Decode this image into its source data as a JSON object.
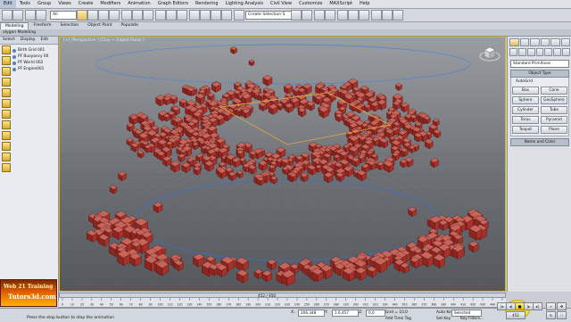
{
  "menu": [
    "Edit",
    "Tools",
    "Group",
    "Views",
    "Create",
    "Modifiers",
    "Animation",
    "Graph Editors",
    "Rendering",
    "Lighting Analysis",
    "Civil View",
    "Customize",
    "MAXScript",
    "Help"
  ],
  "toolbar": {
    "filter_value": "All",
    "selection_set_placeholder": "Create Selection S"
  },
  "ribbon": {
    "tabs": [
      "Modeling",
      "Freeform",
      "Selection",
      "Object Paint",
      "Populate"
    ],
    "active_tab": "Modeling",
    "sub_label": "olygon Modeling"
  },
  "scene_explorer": {
    "tabs": [
      "Select",
      "Display",
      "Edit"
    ],
    "items": [
      "Birth Grid 001",
      "PF Buoyancy 00",
      "PF World 002",
      "PF Engine001"
    ]
  },
  "viewport": {
    "label": "[+] [Perspective ] [Clay + Edged Faces ]"
  },
  "command_panel": {
    "category_dropdown": "Standard Primitives",
    "object_type_title": "Object Type",
    "autogrid_label": "AutoGrid",
    "primitives": [
      "Box",
      "Cone",
      "Sphere",
      "GeoSphere",
      "Cylinder",
      "Tube",
      "Torus",
      "Pyramid",
      "Teapot",
      "Plane"
    ],
    "name_color_title": "Name and Color"
  },
  "time_slider": {
    "label": "452 / 450"
  },
  "track_ticks": [
    "0",
    "10",
    "20",
    "30",
    "40",
    "50",
    "60",
    "70",
    "80",
    "90",
    "100",
    "110",
    "120",
    "130",
    "140",
    "150",
    "160",
    "170",
    "180",
    "190",
    "200",
    "210",
    "220",
    "230",
    "240",
    "250",
    "260",
    "270",
    "280",
    "290",
    "300",
    "310",
    "320",
    "330",
    "340",
    "350",
    "360",
    "370",
    "380",
    "390",
    "400",
    "410",
    "420",
    "430",
    "440",
    "450"
  ],
  "status": {
    "prompt": "Press the stop button to stop the animation",
    "x_value": "206,348",
    "y_value": "1.6,457",
    "z_value": "0,0",
    "grid_label": "Grid = 10,0",
    "add_time_tag": "Add Time Tag",
    "auto_key": "Auto Key",
    "selected_value": "Selected",
    "set_key": "Set Key",
    "key_filters": "Key Filters...",
    "frame_value": "452"
  },
  "logo": {
    "line1": "Web 21 Training",
    "line2": "Tutors3d.com"
  },
  "colors": {
    "accent_highlight": "#ffe200",
    "cube_base": "#a8302a",
    "viewport_bg": "#6d7075"
  }
}
